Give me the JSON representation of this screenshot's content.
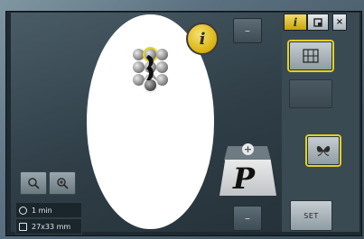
{
  "header": {
    "tab_info_glyph": "i",
    "tab_close_glyph": "×"
  },
  "canvas": {
    "info_glyph": "i"
  },
  "status": {
    "time": "1 min",
    "size": "27x33 mm"
  },
  "preview": {
    "letter": "P",
    "plus_glyph": "+"
  },
  "buttons": {
    "set_label": "SET",
    "minus_glyph": "–"
  },
  "colors": {
    "accent_yellow": "#e2d21d",
    "hoop_white": "#ffffff",
    "panel": "#3a4a53"
  },
  "icons": {
    "tab_info": "info-icon",
    "tab_doc": "document-icon",
    "close": "close-icon",
    "grid": "grid-icon",
    "butterfly": "butterfly-icon",
    "zoom_out": "zoom-out-icon",
    "zoom_in": "zoom-in-icon",
    "clock": "clock-icon",
    "size": "size-icon"
  }
}
